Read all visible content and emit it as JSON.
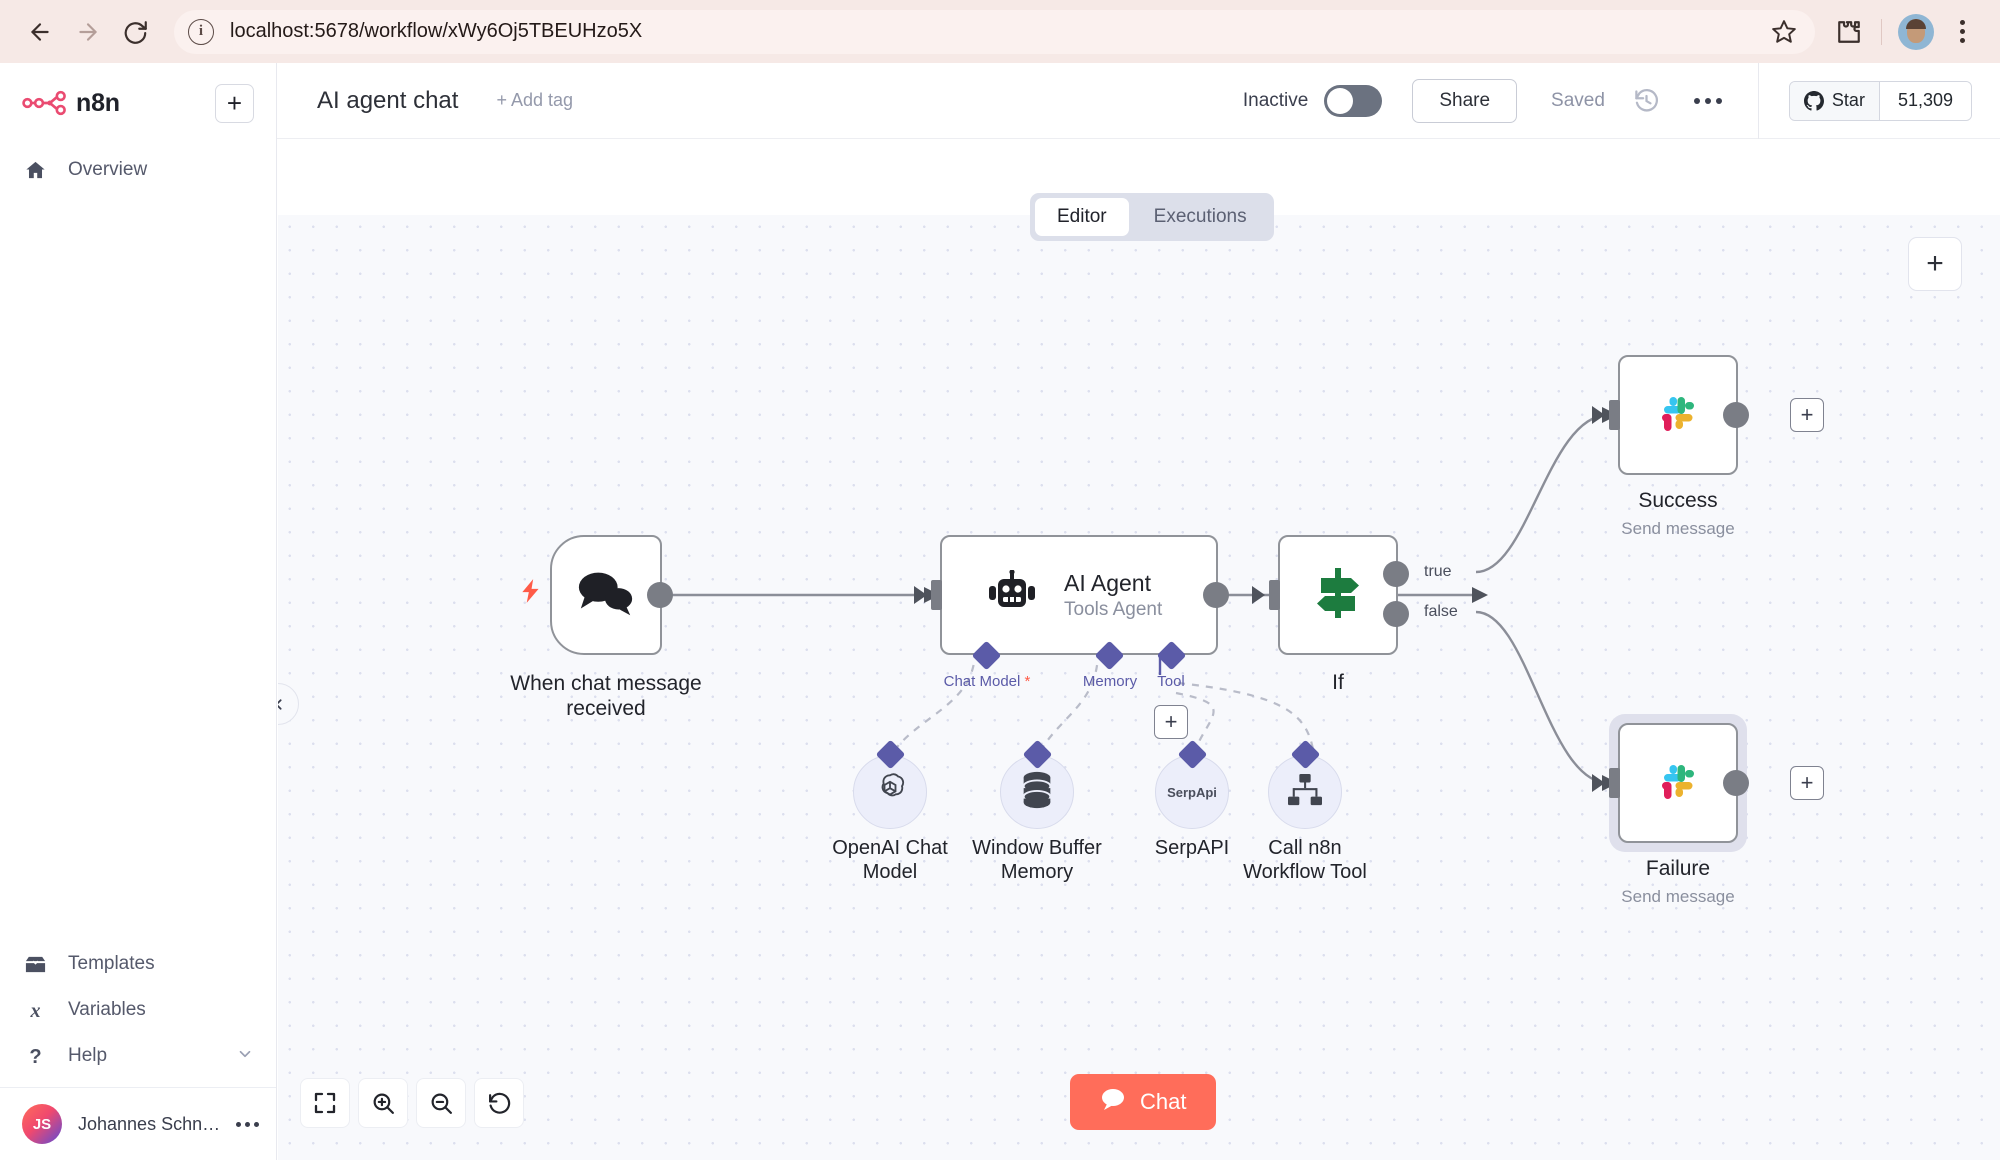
{
  "browser": {
    "back_icon": "arrow-left-icon",
    "forward_icon": "arrow-right-icon",
    "reload_icon": "reload-icon",
    "info_icon": "info-icon",
    "url": "localhost:5678/workflow/xWy6Oj5TBEUHzo5X",
    "bookmark_icon": "star-icon",
    "extensions_icon": "puzzle-icon",
    "profile_icon": "profile-avatar",
    "menu_icon": "kebab-menu-icon"
  },
  "sidebar": {
    "brand": "n8n",
    "add_label": "+",
    "items": [
      {
        "label": "Overview",
        "icon": "home-icon"
      }
    ],
    "bottom_items": [
      {
        "label": "Templates",
        "icon": "box-icon"
      },
      {
        "label": "Variables",
        "icon": "variables-icon"
      },
      {
        "label": "Help",
        "icon": "question-icon",
        "chevron": "⌄"
      }
    ],
    "user": {
      "initials": "JS",
      "name": "Johannes Schn…"
    }
  },
  "header": {
    "workflow_title": "AI agent chat",
    "add_tag": "+ Add tag",
    "activation_label": "Inactive",
    "activation_state": "off",
    "share_label": "Share",
    "save_state": "Saved",
    "history_icon": "history-icon",
    "more_icon": "ellipsis-icon",
    "github": {
      "label": "Star",
      "icon": "github-icon",
      "count": "51,309"
    }
  },
  "tabs": [
    {
      "label": "Editor",
      "active": true
    },
    {
      "label": "Executions",
      "active": false
    }
  ],
  "canvas": {
    "add_node_label": "+",
    "collapse_icon": "chevron-left-icon",
    "nodes": [
      {
        "id": "trigger",
        "name": "When chat message received",
        "subtitle": "",
        "icon": "chat-bubbles-icon",
        "trigger_icon": "lightning-bolt-icon"
      },
      {
        "id": "ai-agent",
        "name": "AI Agent",
        "subtitle": "Tools Agent",
        "icon": "robot-icon",
        "connectors": [
          {
            "label": "Chat Model",
            "required": true
          },
          {
            "label": "Memory",
            "required": false
          },
          {
            "label": "Tool",
            "required": false
          }
        ]
      },
      {
        "id": "if",
        "name": "If",
        "subtitle": "",
        "icon": "signpost-icon",
        "outputs": [
          {
            "label": "true"
          },
          {
            "label": "false"
          }
        ]
      },
      {
        "id": "success",
        "name": "Success",
        "subtitle": "Send message",
        "icon": "slack-icon"
      },
      {
        "id": "failure",
        "name": "Failure",
        "subtitle": "Send message",
        "icon": "slack-icon",
        "selected": true
      }
    ],
    "subnodes": [
      {
        "id": "openai",
        "name": "OpenAI Chat Model",
        "icon": "openai-icon"
      },
      {
        "id": "memory",
        "name": "Window Buffer Memory",
        "icon": "database-icon"
      },
      {
        "id": "serpapi",
        "name": "SerpAPI",
        "icon": "serpapi-icon",
        "icon_text": "SerpApi"
      },
      {
        "id": "n8ntool",
        "name": "Call n8n Workflow Tool",
        "icon": "sitemap-icon"
      }
    ],
    "add_tool_label": "+",
    "add_after_success_label": "+",
    "add_after_failure_label": "+"
  },
  "toolbar": {
    "buttons": [
      {
        "name": "zoom-to-fit",
        "icon": "fit-screen-icon"
      },
      {
        "name": "zoom-in",
        "icon": "zoom-in-icon"
      },
      {
        "name": "zoom-out",
        "icon": "zoom-out-icon"
      },
      {
        "name": "reset-zoom",
        "icon": "reset-icon"
      }
    ],
    "chat_label": "Chat",
    "chat_icon": "chat-icon"
  },
  "colors": {
    "accent": "#ff6d5a",
    "brand": "#ea4b71",
    "connector": "#5b5ba8",
    "canvas_bg": "#f8f9fc",
    "node_border": "#909399"
  }
}
